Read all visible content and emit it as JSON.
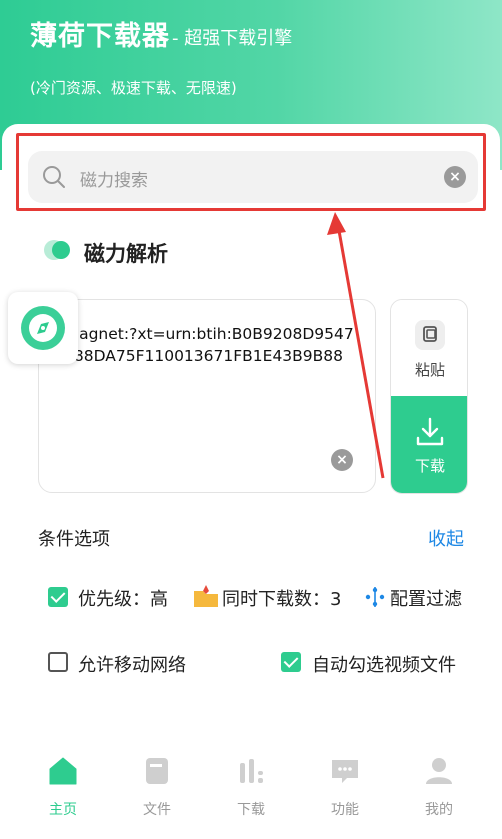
{
  "header": {
    "title": "薄荷下载器",
    "subtitle": "- 超强下载引擎",
    "tagline": "(冷门资源、极速下载、无限速)"
  },
  "search": {
    "placeholder": "磁力搜索"
  },
  "section": {
    "title": "磁力解析"
  },
  "magnet": {
    "text": "magnet:?xt=urn:btih:B0B9208D9547088DA75F110013671FB1E43B9B88"
  },
  "actions": {
    "paste_label": "粘贴",
    "download_label": "下载"
  },
  "options": {
    "title": "条件选项",
    "collapse_label": "收起",
    "priority_label": "优先级：高",
    "concurrent_label": "同时下载数：3",
    "filter_label": "配置过滤",
    "mobile_network_label": "允许移动网络",
    "auto_select_label": "自动勾选视频文件"
  },
  "nav": {
    "items": [
      {
        "label": "主页",
        "icon": "home-icon"
      },
      {
        "label": "文件",
        "icon": "file-icon"
      },
      {
        "label": "下载",
        "icon": "download-stats-icon"
      },
      {
        "label": "功能",
        "icon": "chat-icon"
      },
      {
        "label": "我的",
        "icon": "user-icon"
      }
    ]
  },
  "colors": {
    "accent": "#2ecc8f",
    "link": "#1e88e5",
    "highlight": "#e53935"
  }
}
